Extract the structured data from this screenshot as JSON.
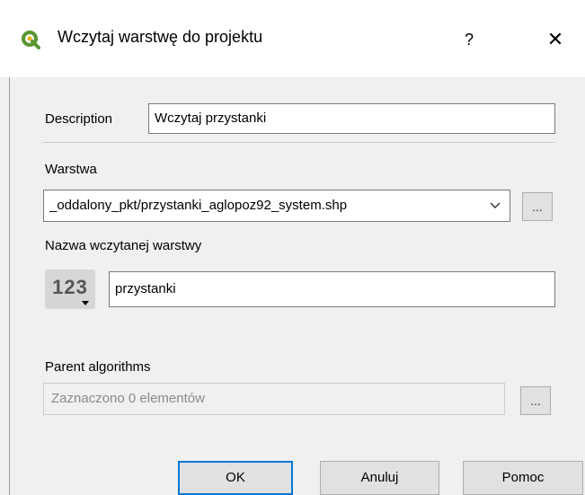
{
  "dialog": {
    "title": "Wczytaj warstwę do projektu",
    "help_glyph": "?",
    "close_glyph": "✕",
    "icon": "qgis-logo-icon"
  },
  "description": {
    "label": "Description",
    "value": "Wczytaj przystanki"
  },
  "layer": {
    "label": "Warstwa",
    "selected_value": "_oddalony_pkt/przystanki_aglopoz92_system.shp",
    "browse_label": "..."
  },
  "layer_name": {
    "label": "Nazwa wczytanej warstwy",
    "type_button": "123",
    "value": "przystanki"
  },
  "parent_algorithms": {
    "label": "Parent algorithms",
    "value": "Zaznaczono 0 elementów",
    "browse_label": "..."
  },
  "buttons": {
    "ok": "OK",
    "cancel": "Anuluj",
    "help": "Pomoc"
  },
  "colors": {
    "window_bg": "#f0f0f0",
    "accent_border": "#0078d7",
    "qgis_green": "#589632",
    "qgis_yellow": "#eeb111"
  }
}
